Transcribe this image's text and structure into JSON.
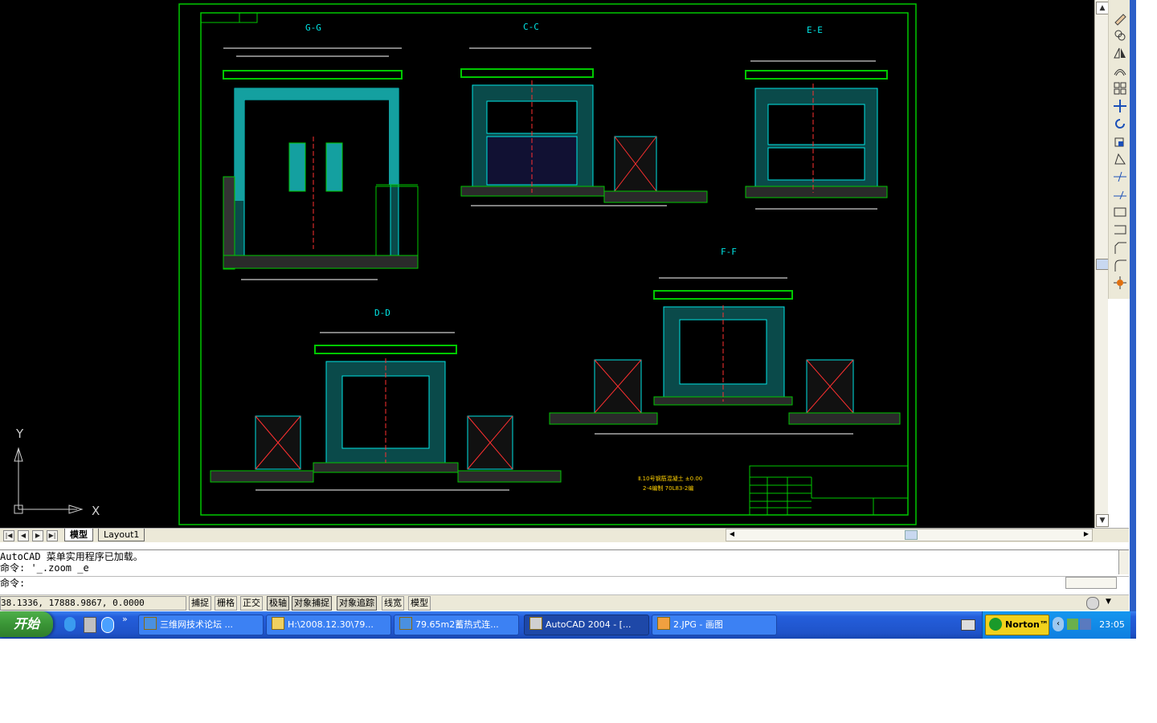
{
  "drawing": {
    "views": [
      {
        "label": "G-G"
      },
      {
        "label": "C-C"
      },
      {
        "label": "E-E"
      },
      {
        "label": "F-F"
      },
      {
        "label": "D-D"
      }
    ],
    "ucs": {
      "y": "Y",
      "x": "X"
    },
    "notes": [
      "Ⅱ.10号钢筋混凝土 ±0.00",
      "2-4编制 70L83-2编"
    ],
    "colors": {
      "frame": "#00c800",
      "cyan": "#00e5e5",
      "dim": "#ffffff",
      "red": "#ff3030"
    }
  },
  "layout_tabs": {
    "model": "模型",
    "layout1": "Layout1"
  },
  "command": {
    "history_1": "AutoCAD 菜单实用程序已加载。",
    "history_2": "命令: '_.zoom _e",
    "prompt": "命令:"
  },
  "status": {
    "coords": "38.1336, 17888.9867, 0.0000",
    "buttons": [
      "捕捉",
      "栅格",
      "正交",
      "极轴",
      "对象捕捉",
      "对象追踪",
      "线宽",
      "模型"
    ]
  },
  "taskbar": {
    "start": "开始",
    "items": [
      "三维网技术论坛 ...",
      "H:\\2008.12.30\\79...",
      "79.65m2蓄热式连...",
      "AutoCAD 2004 - [...",
      "2.JPG - 画图"
    ],
    "tray_norton": "Norton™",
    "clock": "23:05"
  }
}
